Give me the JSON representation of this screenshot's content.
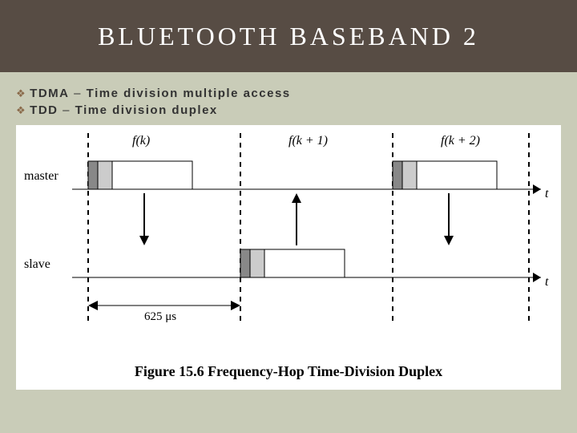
{
  "slide": {
    "title": "BLUETOOTH BASEBAND 2",
    "bullets": [
      {
        "term": "TDMA",
        "sep": " – ",
        "rest": "Time division multiple access"
      },
      {
        "term": "TDD",
        "sep": " – ",
        "rest": "Time division duplex"
      }
    ]
  },
  "figure": {
    "caption": "Figure 15.6  Frequency-Hop Time-Division Duplex",
    "slot_labels": [
      "f(k)",
      "f(k + 1)",
      "f(k + 2)"
    ],
    "row_labels": [
      "master",
      "slave"
    ],
    "time_axis_label": "t",
    "slot_width_label": "625 μs"
  }
}
